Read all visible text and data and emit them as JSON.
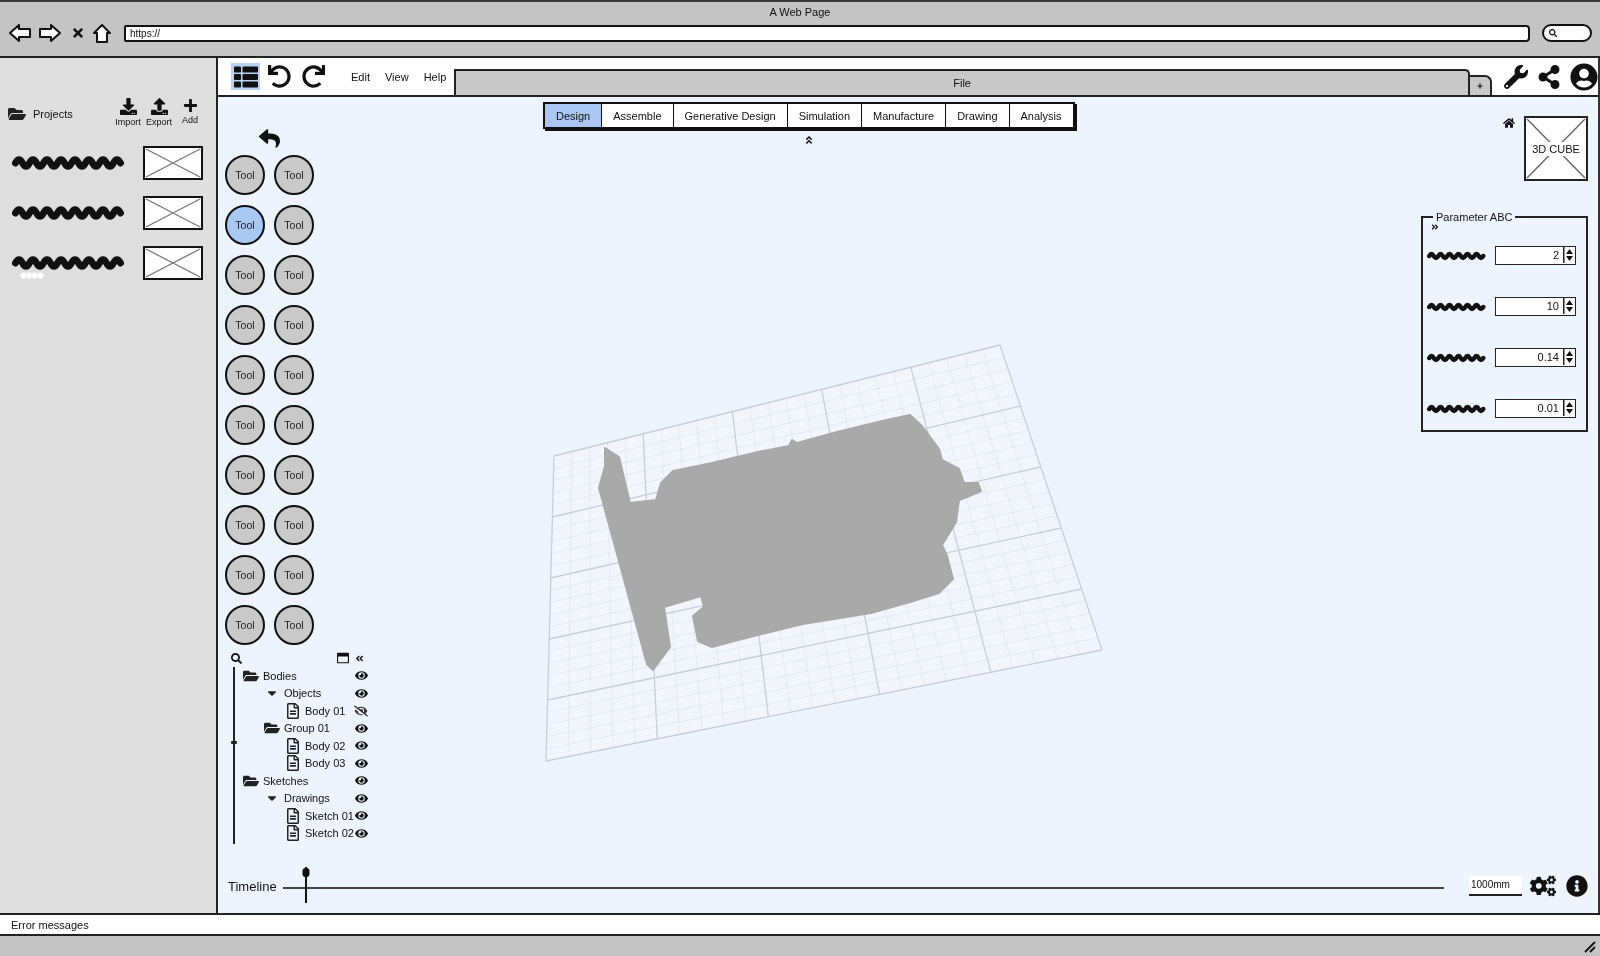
{
  "browser": {
    "title": "A Web Page",
    "url": "https://"
  },
  "projects_panel": {
    "title": "Projects",
    "actions": [
      {
        "label": "Import"
      },
      {
        "label": "Export"
      },
      {
        "label": "Add"
      }
    ]
  },
  "toolbar": {
    "view_toggle": {
      "selected": true
    },
    "menus": [
      {
        "label": "Edit"
      },
      {
        "label": "View"
      },
      {
        "label": "Help"
      }
    ],
    "document_tab": {
      "label": "File"
    }
  },
  "workspace_tabs": [
    {
      "label": "Design",
      "selected": true
    },
    {
      "label": "Assemble",
      "selected": false
    },
    {
      "label": "Generative Design",
      "selected": false
    },
    {
      "label": "Simulation",
      "selected": false
    },
    {
      "label": "Manufacture",
      "selected": false
    },
    {
      "label": "Drawing",
      "selected": false
    },
    {
      "label": "Analysis",
      "selected": false
    }
  ],
  "tools": [
    {
      "label": "Tool",
      "selected": false
    },
    {
      "label": "Tool",
      "selected": false
    },
    {
      "label": "Tool",
      "selected": true
    },
    {
      "label": "Tool",
      "selected": false
    },
    {
      "label": "Tool",
      "selected": false
    },
    {
      "label": "Tool",
      "selected": false
    },
    {
      "label": "Tool",
      "selected": false
    },
    {
      "label": "Tool",
      "selected": false
    },
    {
      "label": "Tool",
      "selected": false
    },
    {
      "label": "Tool",
      "selected": false
    },
    {
      "label": "Tool",
      "selected": false
    },
    {
      "label": "Tool",
      "selected": false
    },
    {
      "label": "Tool",
      "selected": false
    },
    {
      "label": "Tool",
      "selected": false
    },
    {
      "label": "Tool",
      "selected": false
    },
    {
      "label": "Tool",
      "selected": false
    },
    {
      "label": "Tool",
      "selected": false
    },
    {
      "label": "Tool",
      "selected": false
    },
    {
      "label": "Tool",
      "selected": false
    },
    {
      "label": "Tool",
      "selected": false
    }
  ],
  "browser_tree": {
    "items": [
      {
        "kind": "folder",
        "label": "Bodies",
        "expanded": true,
        "visible": true,
        "children": [
          {
            "kind": "group",
            "label": "Objects",
            "expanded": true,
            "visible": true,
            "children": [
              {
                "kind": "file",
                "label": "Body 01",
                "visible": false
              }
            ]
          },
          {
            "kind": "folder",
            "label": "Group 01",
            "expanded": true,
            "visible": true,
            "children": [
              {
                "kind": "file",
                "label": "Body 02",
                "visible": true
              },
              {
                "kind": "file",
                "label": "Body 03",
                "visible": true
              }
            ]
          }
        ]
      },
      {
        "kind": "folder",
        "label": "Sketches",
        "expanded": true,
        "visible": true,
        "children": [
          {
            "kind": "group",
            "label": "Drawings",
            "expanded": true,
            "visible": true,
            "children": [
              {
                "kind": "file",
                "label": "Sketch 01",
                "visible": true
              },
              {
                "kind": "file",
                "label": "Sketch 02",
                "visible": true
              }
            ]
          }
        ]
      }
    ]
  },
  "view_cube": {
    "label": "3D CUBE"
  },
  "parameters": {
    "title": "Parameter ABC",
    "fields": [
      {
        "value": "2"
      },
      {
        "value": "10"
      },
      {
        "value": "0.14"
      },
      {
        "value": "0.01"
      }
    ]
  },
  "timeline": {
    "label": "Timeline",
    "level": 0.02
  },
  "scale": {
    "value": "1000mm"
  },
  "status_bar": {
    "message": "Error messages"
  }
}
